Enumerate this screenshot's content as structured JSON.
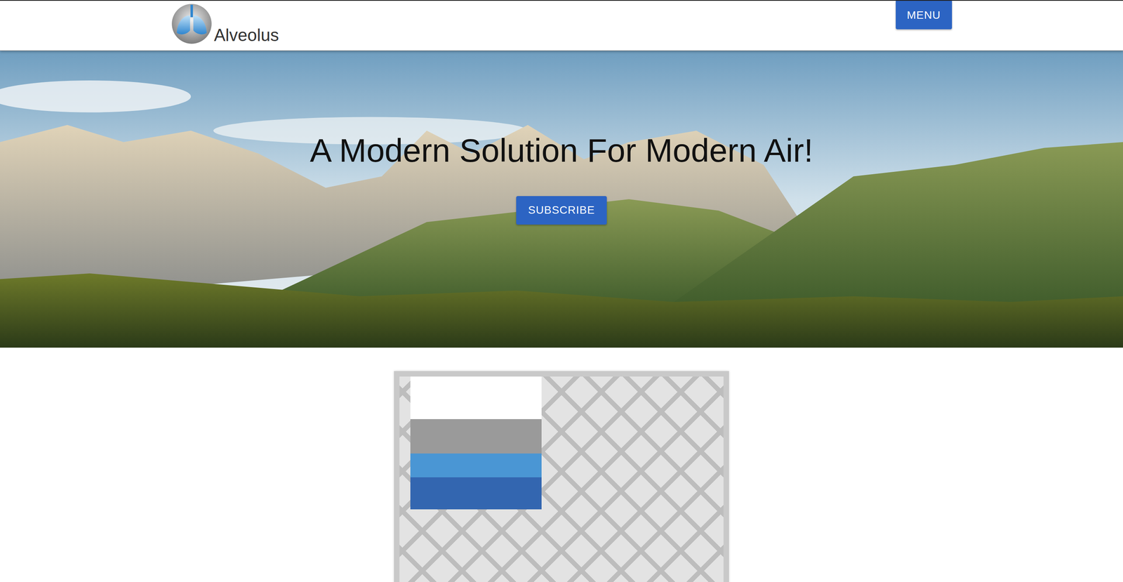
{
  "header": {
    "logo_text": "Alveolus",
    "menu_button": "MENU"
  },
  "hero": {
    "title": "A Modern Solution For Modern Air!",
    "subscribe_button": "SUBSCRIBE"
  }
}
